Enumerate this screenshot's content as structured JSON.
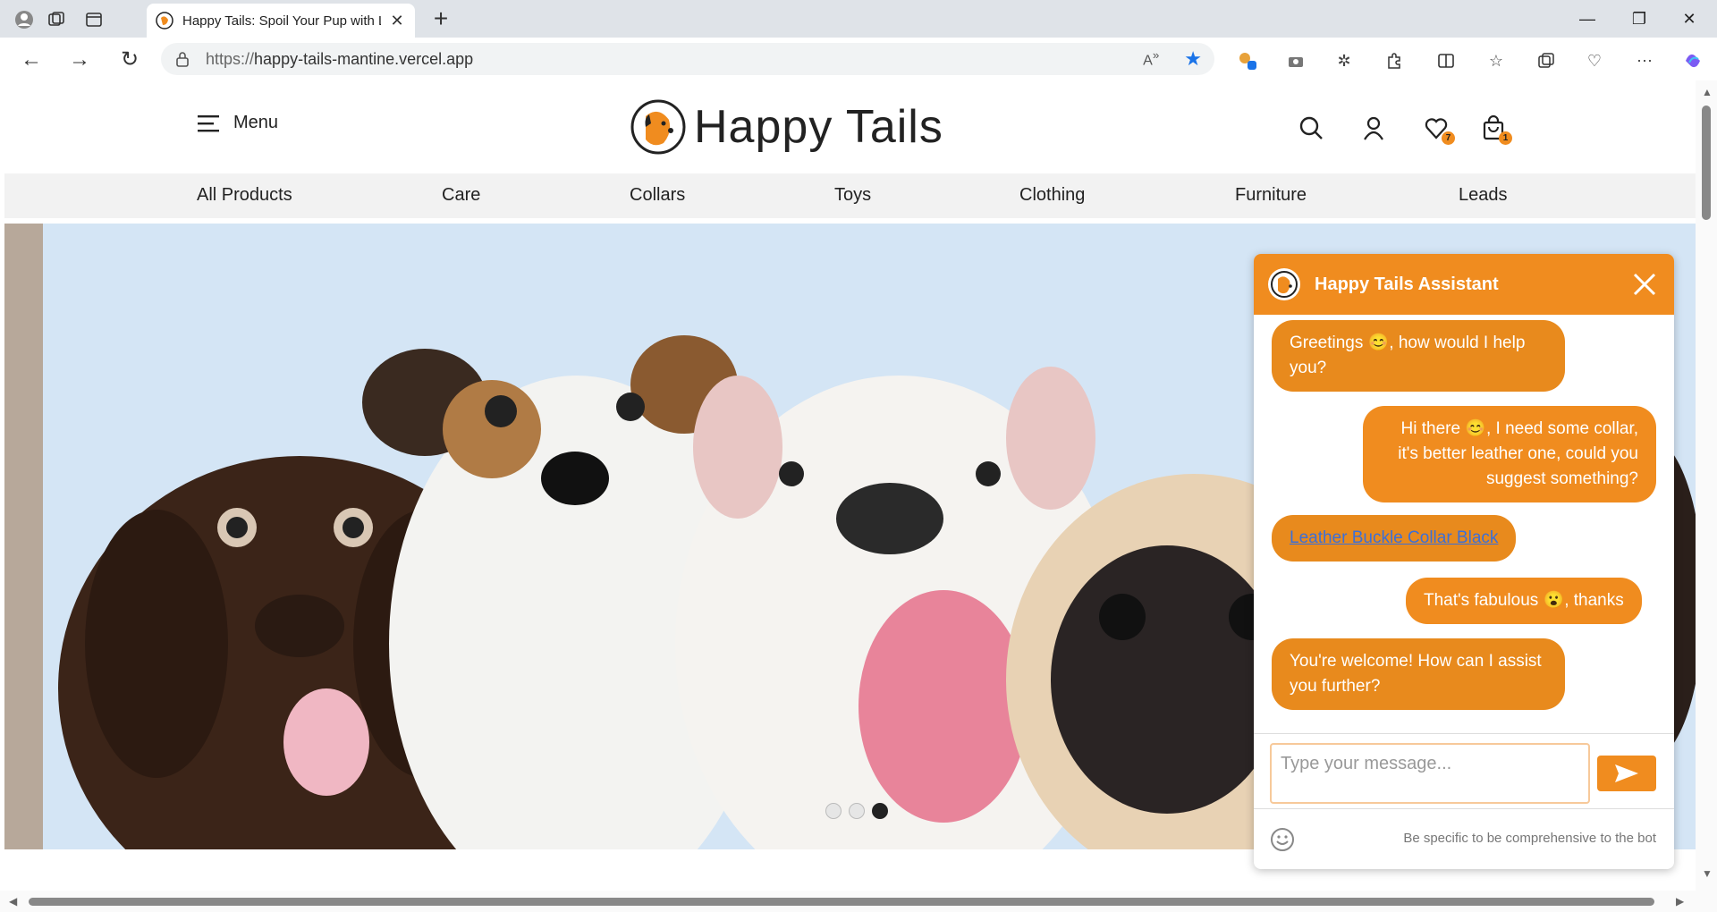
{
  "browser": {
    "tab_title": "Happy Tails: Spoil Your Pup with L",
    "url_scheme": "https://",
    "url_host": "happy-tails-mantine.vercel.app",
    "read_aloud_label": "A̅"
  },
  "header": {
    "menu_label": "Menu",
    "brand_name": "Happy Tails",
    "wishlist_count": "7",
    "cart_count": "1"
  },
  "categories": [
    "All Products",
    "Care",
    "Collars",
    "Toys",
    "Clothing",
    "Furniture",
    "Leads"
  ],
  "hero": {
    "slide_count": 3,
    "active_slide": 3
  },
  "chat": {
    "title": "Happy Tails Assistant",
    "messages": [
      {
        "from": "bot",
        "text": "Greetings 😊, how would I help you?"
      },
      {
        "from": "user",
        "text": "Hi there 😊, I need some collar, it's better leather one, could you suggest something?"
      },
      {
        "from": "bot",
        "text": "Leather Buckle Collar Black",
        "is_link": true
      },
      {
        "from": "user",
        "text": "That's fabulous 😮, thanks"
      },
      {
        "from": "bot",
        "text": "You're welcome! How can I assist you further?"
      }
    ],
    "input_placeholder": "Type your message...",
    "hint": "Be specific to be comprehensive to the bot"
  },
  "colors": {
    "accent": "#f08c1f",
    "bot_bubble": "#e88a1d",
    "link": "#3b6fd8",
    "hero_bg": "#d4e5f5"
  }
}
